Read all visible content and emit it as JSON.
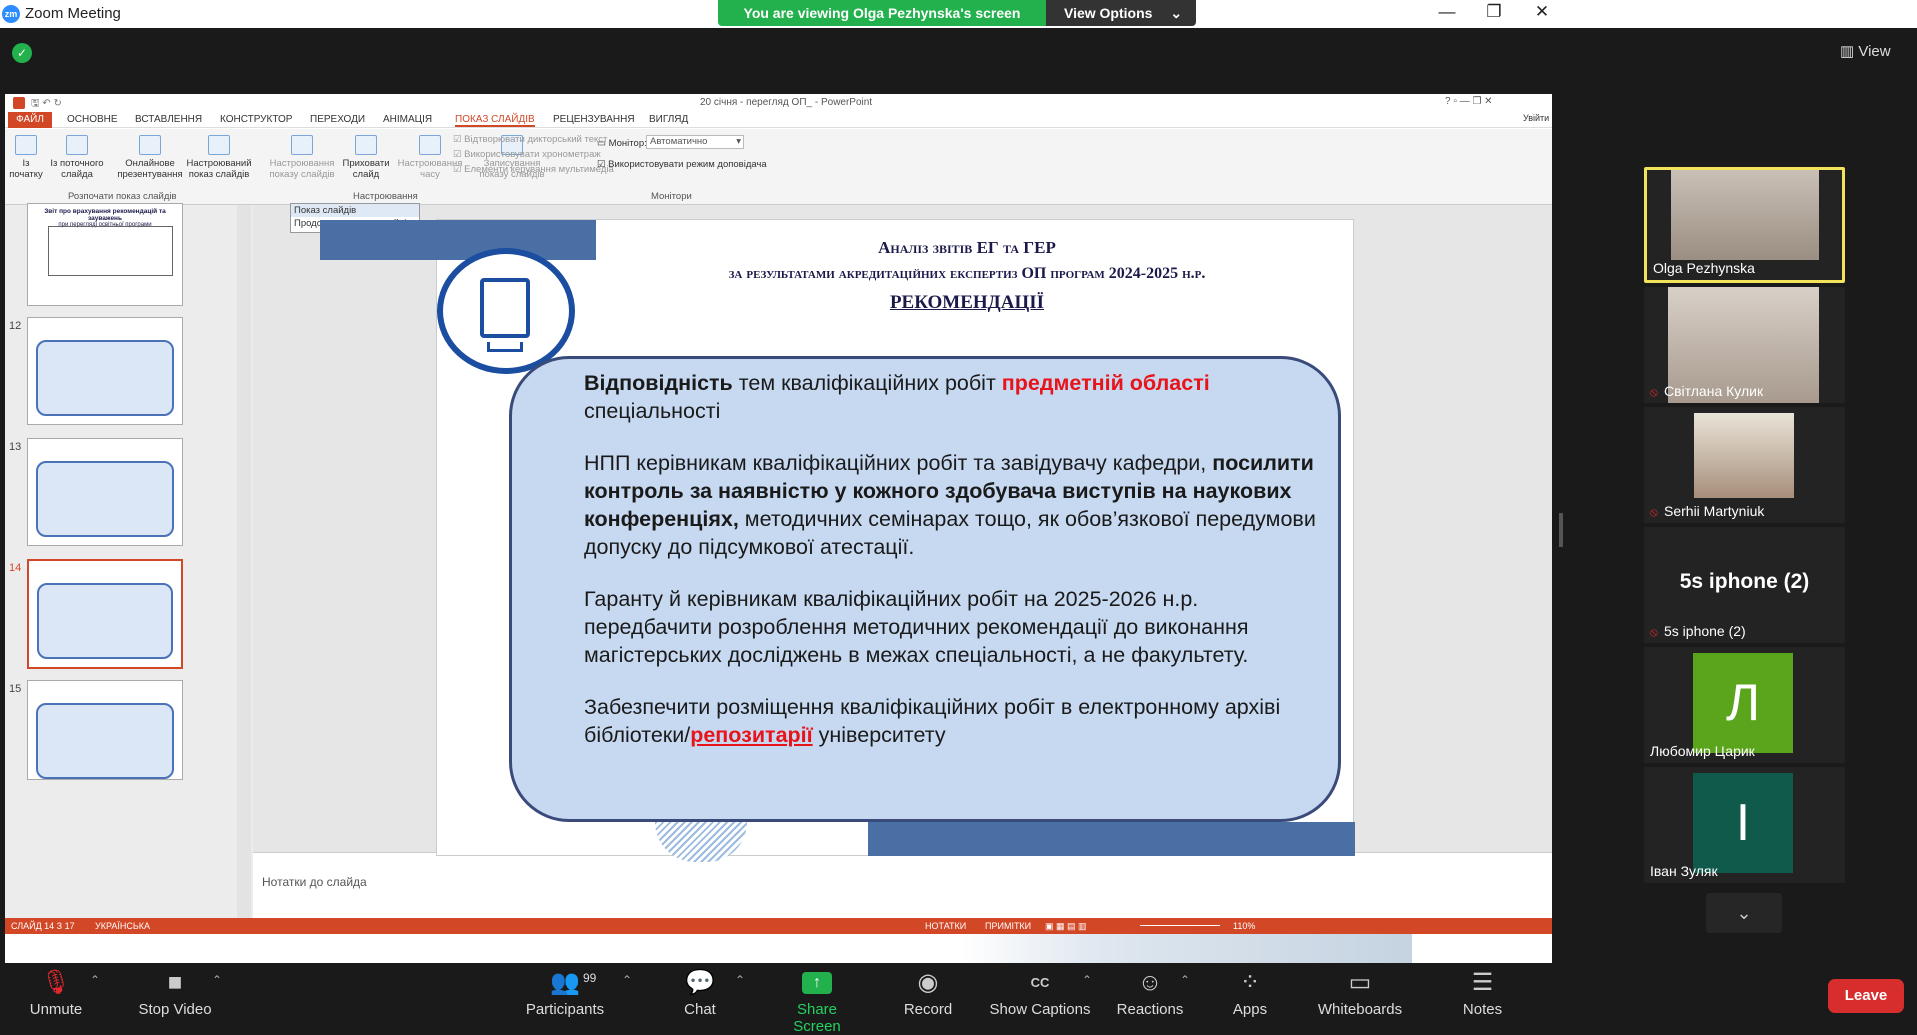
{
  "window": {
    "app_title": "Zoom Meeting",
    "logo": "zm",
    "banner": "You are viewing Olga Pezhynska's screen",
    "view_options": "View Options",
    "view_btn": "View",
    "minimize": "—",
    "restore": "❐",
    "close": "✕"
  },
  "ppt": {
    "title": "20 січня - перегляд ОП_ - PowerPoint",
    "tabs": [
      "ФАЙЛ",
      "ОСНОВНЕ",
      "ВСТАВЛЕННЯ",
      "КОНСТРУКТОР",
      "ПЕРЕХОДИ",
      "АНІМАЦІЯ",
      "ПОКАЗ СЛАЙДІВ",
      "РЕЦЕНЗУВАННЯ",
      "ВИГЛЯД"
    ],
    "signin": "Увійти",
    "ribbon": {
      "b1": [
        "Із",
        "початку"
      ],
      "b2": [
        "Із поточного",
        "слайда"
      ],
      "b3": [
        "Онлайнове",
        "презентування"
      ],
      "b4": [
        "Настроюваний",
        "показ слайдів"
      ],
      "b5": [
        "Настроювання",
        "показу слайдів"
      ],
      "b6": [
        "Приховати",
        "слайд"
      ],
      "b7": [
        "Настроювання",
        "часу"
      ],
      "b8": [
        "Записування",
        "показу слайдів"
      ],
      "chk1": "Відтворювати дикторський текст",
      "chk2": "Використовувати хронометраж",
      "chk3": "Елементи керування мультимедіа",
      "monitor_label": "Монітор:",
      "monitor_value": "Автоматично",
      "presenter": "Використовувати режим доповідача",
      "grp1": "Розпочати показ слайдів",
      "grp2": "Настроювання",
      "grp3": "Монітори"
    },
    "popup": {
      "title": "Показ слайдів",
      "item": "Продовжити показ слайдів"
    },
    "thumb_numbers": [
      "12",
      "13",
      "14",
      "15"
    ],
    "thumb11_title": "Звіт про врахування рекомендацій та зауважень",
    "thumb11_sub": "при перегляді освітньої програми",
    "slide": {
      "h1_a": "Аналіз звітів ЕГ та ГЕР",
      "h1_b": "за результатами акредитаційних експертиз ОП програм 2024-2025 н.р.",
      "h1_c": "РЕКОМЕНДАЦІЇ",
      "p1_b": "Відповідність",
      "p1_t": " тем кваліфікаційних робіт ",
      "p1_r": "предметній області",
      "p1_e": " спеціальності",
      "p2_t": "НПП керівникам кваліфікаційних робіт та завідувачу кафедри, ",
      "p2_b": "посилити контроль за наявністю у кожного здобувача виступів на наукових конференціях,",
      "p2_e": " методичних семінарах тощо, як обов’язкової передумови допуску до підсумкової атестації.",
      "p3": "Гаранту й керівникам кваліфікаційних робіт на 2025-2026 н.р. передбачити розроблення методичних рекомендації до виконання магістерських досліджень в межах спеціальності, а не факультету.",
      "p4_t": "Забезпечити розміщення кваліфікаційних робіт в електронному архіві бібліотеки/",
      "p4_r": "репозитарії",
      "p4_e": " університету"
    },
    "notes": "Нотатки до слайда",
    "status": {
      "slide": "СЛАЙД 14 З 17",
      "lang": "УКРАЇНСЬКА",
      "notes": "НОТАТКИ",
      "comments": "ПРИМІТКИ",
      "zoom": "110%"
    }
  },
  "gallery": [
    {
      "name": "Olga Pezhynska",
      "muted": false
    },
    {
      "name": "Світлана Кулик",
      "muted": true
    },
    {
      "name": "Serhii Martyniuk",
      "muted": true
    },
    {
      "name": "5s iphone (2)",
      "muted": true,
      "big": "5s iphone (2)"
    },
    {
      "name": "Любомир Царик",
      "muted": false,
      "initial": "Л",
      "color": "#5aa51c"
    },
    {
      "name": "Іван Зуляк",
      "muted": false,
      "initial": "І",
      "color": "#0f5a4a"
    }
  ],
  "toolbar": {
    "unmute": "Unmute",
    "video": "Stop Video",
    "participants": "Participants",
    "participants_count": "99",
    "chat": "Chat",
    "share": "Share Screen",
    "record": "Record",
    "captions": "Show Captions",
    "reactions": "Reactions",
    "apps": "Apps",
    "whiteboards": "Whiteboards",
    "notes": "Notes",
    "leave": "Leave"
  }
}
